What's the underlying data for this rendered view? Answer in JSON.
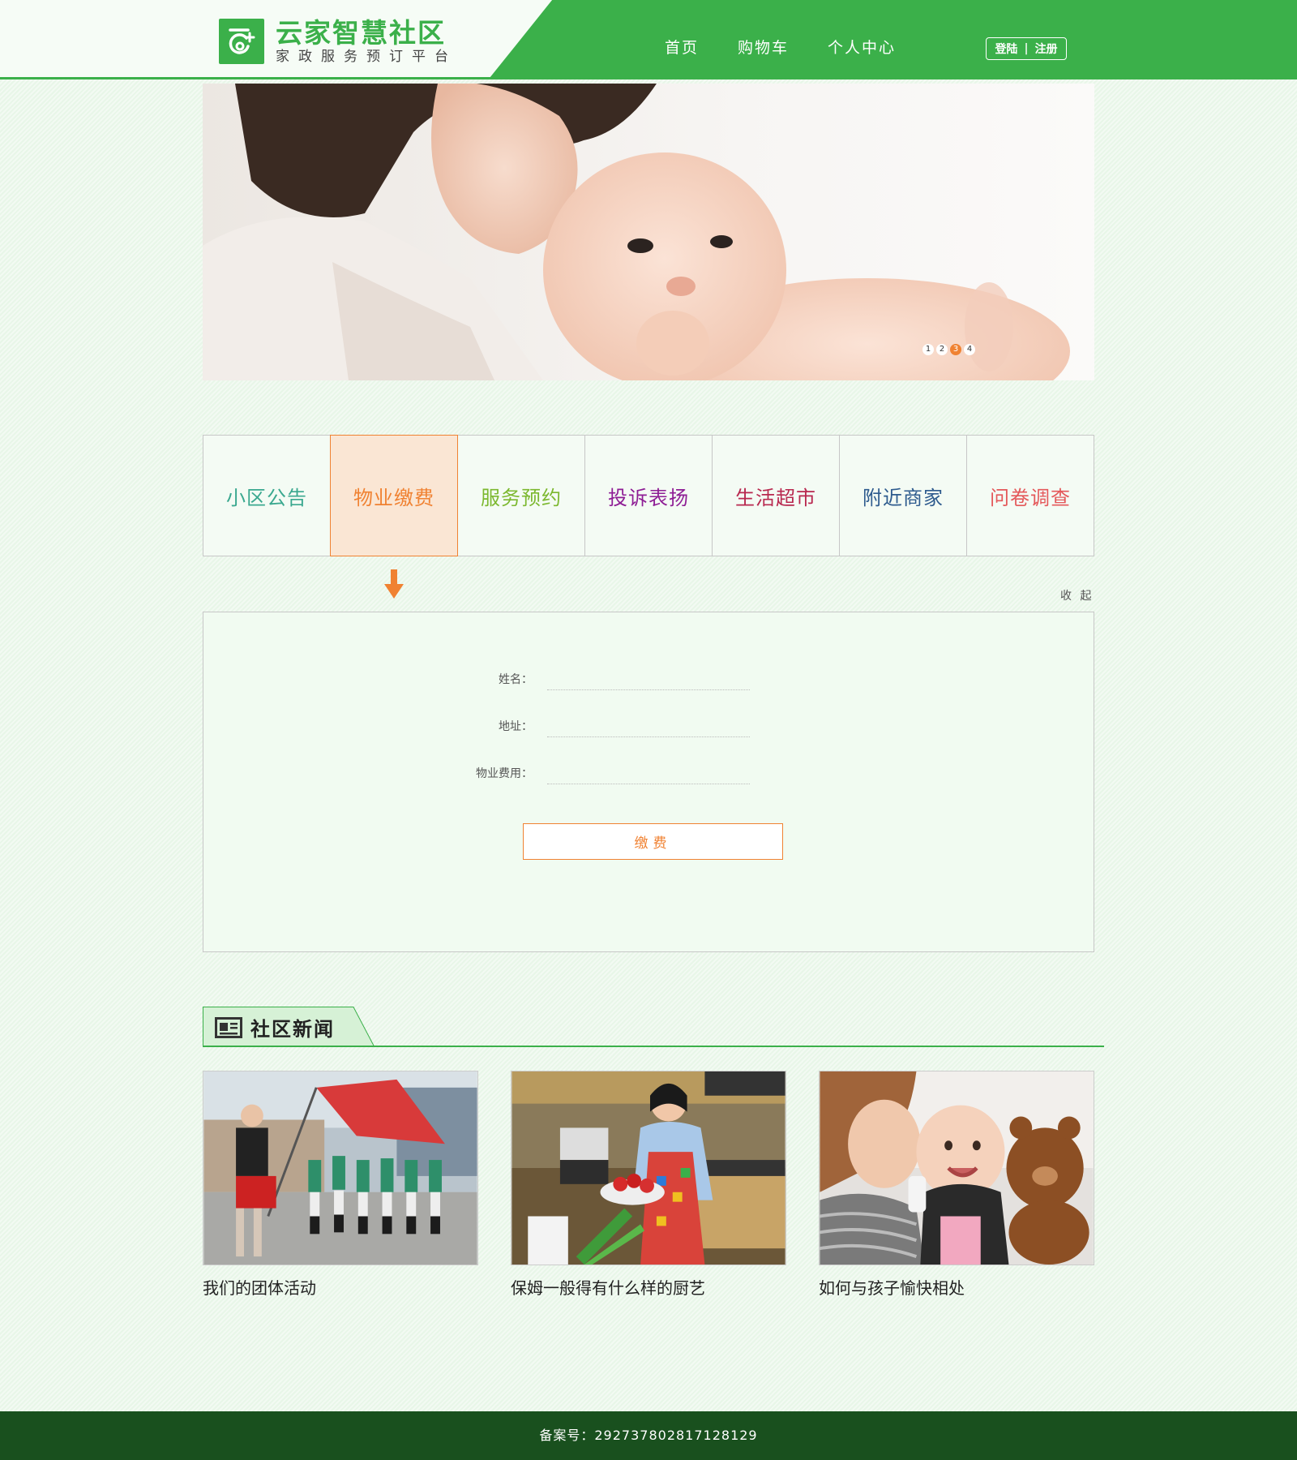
{
  "header": {
    "logo_title": "云家智慧社区",
    "logo_subtitle": "家政服务预订平台",
    "nav": [
      "首页",
      "购物车",
      "个人中心"
    ],
    "login_label": "登陆",
    "register_label": "注册",
    "separator": "|"
  },
  "banner": {
    "dots": [
      "1",
      "2",
      "3",
      "4"
    ],
    "active_dot": "3"
  },
  "tabs": [
    {
      "label": "小区公告",
      "color": "#3aa88f"
    },
    {
      "label": "物业缴费",
      "color": "#f08232"
    },
    {
      "label": "服务预约",
      "color": "#7cb82f"
    },
    {
      "label": "投诉表扬",
      "color": "#8e1d95"
    },
    {
      "label": "生活超市",
      "color": "#b8284f"
    },
    {
      "label": "附近商家",
      "color": "#2e5b8e"
    },
    {
      "label": "问卷调查",
      "color": "#e4585a"
    }
  ],
  "collapse_label": "收 起",
  "form": {
    "name_label": "姓名：",
    "address_label": "地址：",
    "fee_label": "物业费用：",
    "name_value": "",
    "address_value": "",
    "fee_value": "",
    "pay_button": "缴费"
  },
  "news": {
    "title": "社区新闻",
    "items": [
      {
        "caption": "我们的团体活动"
      },
      {
        "caption": "保姆一般得有什么样的厨艺"
      },
      {
        "caption": "如何与孩子愉快相处"
      }
    ]
  },
  "footer": {
    "text": "备案号：292737802817128129"
  },
  "colors": {
    "brand_green": "#3bb04a",
    "accent_orange": "#f08232",
    "footer_green": "#19501e"
  }
}
